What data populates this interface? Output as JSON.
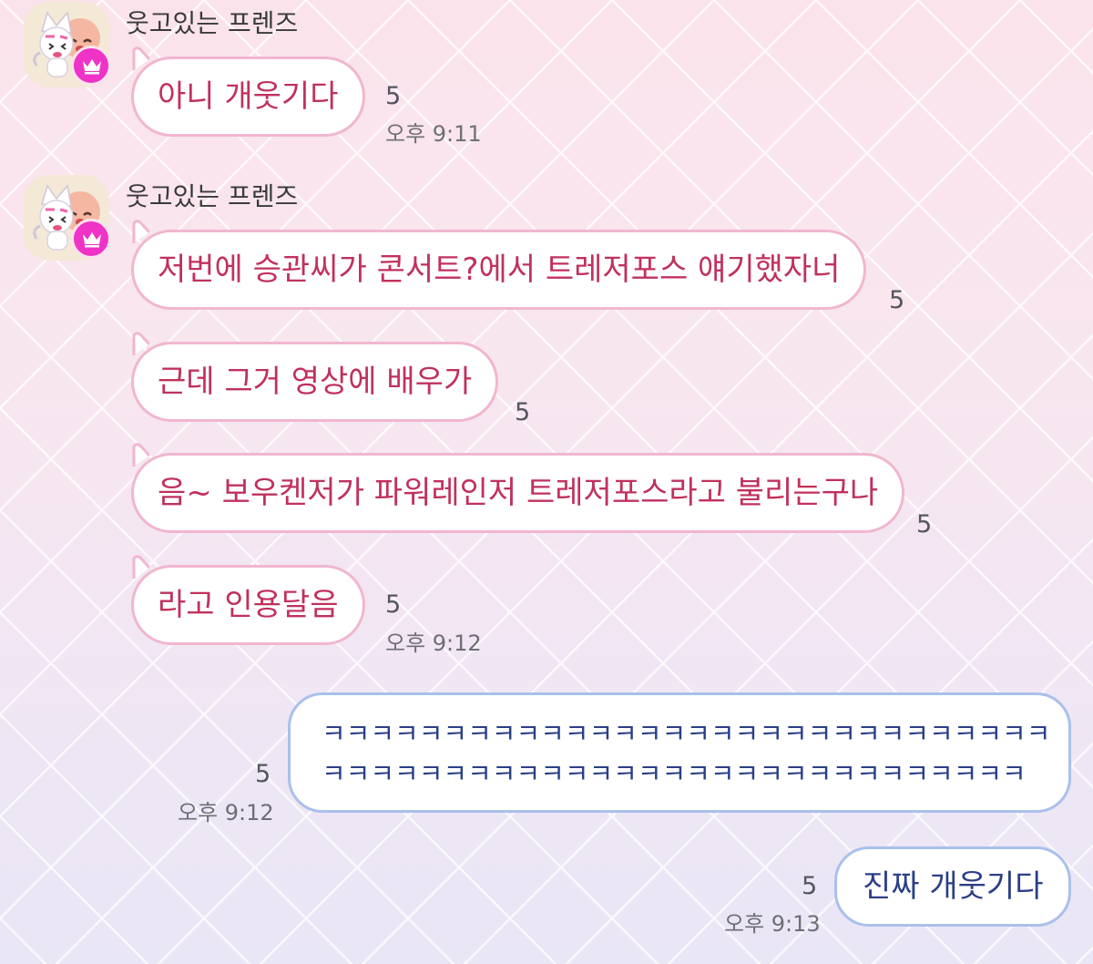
{
  "chat": {
    "sender": "웃고있는 프렌즈",
    "messages": [
      {
        "text": "아니 개웃기다",
        "unread": "5",
        "time": "오후 9:11"
      },
      {
        "text": "저번에 승관씨가 콘서트?에서 트레저포스 얘기했자너",
        "unread": "5"
      },
      {
        "text": "근데 그거 영상에 배우가",
        "unread": "5"
      },
      {
        "text": "음~ 보우켄저가 파워레인저 트레저포스라고 불리는구나",
        "unread": "5"
      },
      {
        "text": "라고 인용달음",
        "unread": "5",
        "time": "오후 9:12"
      }
    ],
    "mine": [
      {
        "lines": [
          "ㅋㅋㅋㅋㅋㅋㅋㅋㅋㅋㅋㅋㅋㅋㅋㅋㅋㅋㅋㅋㅋㅋㅋㅋㅋㅋㅋㅋㅋㅋ",
          "ㅋㅋㅋㅋㅋㅋㅋㅋㅋㅋㅋㅋㅋㅋㅋㅋㅋㅋㅋㅋㅋㅋㅋㅋㅋㅋㅋㅋㅋ"
        ],
        "unread": "5",
        "time": "오후 9:12"
      },
      {
        "text": "진짜 개웃기다",
        "unread": "5",
        "time": "오후 9:13"
      }
    ]
  },
  "colors": {
    "incoming_text": "#c0315c",
    "incoming_border": "#f1b6cf",
    "outgoing_text": "#2a3f86",
    "outgoing_border": "#a9c0ea",
    "badge": "#ee33c6"
  },
  "icons": {
    "avatar": "friends-character-icon",
    "badge": "crown-icon"
  }
}
